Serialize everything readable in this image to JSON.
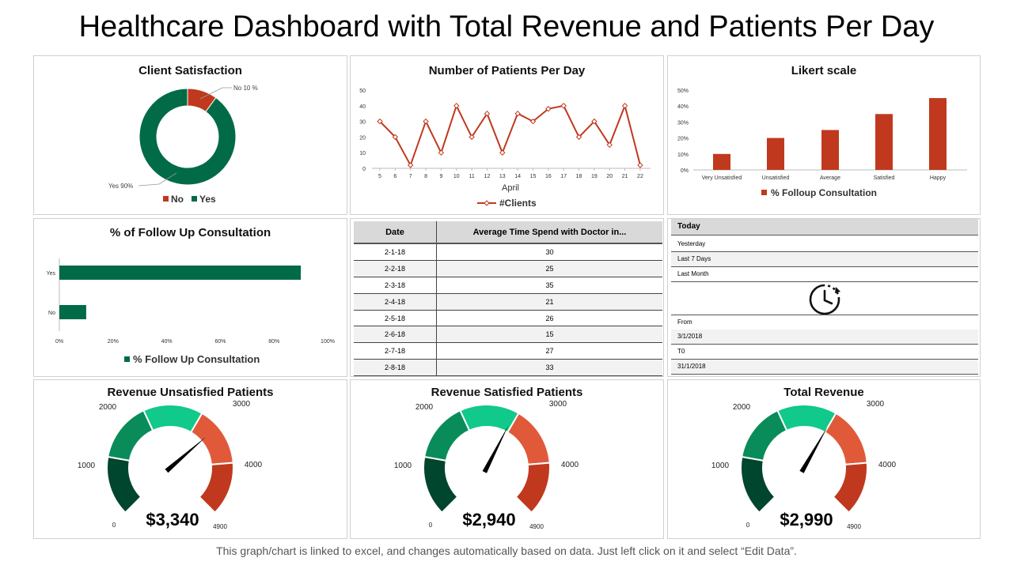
{
  "title": "Healthcare Dashboard with Total Revenue and Patients Per Day",
  "footnote": "This graph/chart is linked to excel, and changes automatically  based on data. Just left click on it and select “Edit Data”.",
  "colors": {
    "green": "#006b46",
    "red": "#c0391e",
    "orange": "#e05a3a",
    "light_green": "#10c98a",
    "mid_green": "#0a8c5a",
    "dark_green": "#00452e"
  },
  "client_satisfaction": {
    "title": "Client Satisfaction",
    "label_no": "No 10  %",
    "label_yes": "Yes 90%",
    "legend_no": "No",
    "legend_yes": "Yes"
  },
  "patients_per_day": {
    "title": "Number of Patients Per Day",
    "xlabel": "April",
    "legend": "#Clients"
  },
  "likert": {
    "title": "Likert scale",
    "legend": "% Folloup Consultation"
  },
  "follow_up": {
    "title": "% of Follow Up Consultation",
    "legend": "% Follow Up Consultation"
  },
  "time_table": {
    "headers": [
      "Date",
      "Average Time Spend with Doctor in..."
    ],
    "rows": [
      [
        "2-1-18",
        "30"
      ],
      [
        "2-2-18",
        "25"
      ],
      [
        "2-3-18",
        "35"
      ],
      [
        "2-4-18",
        "21"
      ],
      [
        "2-5-18",
        "26"
      ],
      [
        "2-6-18",
        "15"
      ],
      [
        "2-7-18",
        "27"
      ],
      [
        "2-8-18",
        "33"
      ]
    ]
  },
  "date_filter": {
    "today": "Today",
    "yesterday": "Yesterday",
    "last7": "Last 7 Days",
    "last_month": "Last Month",
    "from_label": "From",
    "from_value": "3/1/2018",
    "to_label": "T0",
    "to_value": "31/1/2018",
    "icon": "clock-history-icon"
  },
  "gauges": [
    {
      "title": "Revenue Unsatisfied Patients",
      "value_text": "$3,340"
    },
    {
      "title": "Revenue Satisfied Patients",
      "value_text": "$2,940"
    },
    {
      "title": "Total Revenue",
      "value_text": "$2,990"
    }
  ],
  "chart_data": [
    {
      "type": "pie",
      "title": "Client Satisfaction",
      "categories": [
        "No",
        "Yes"
      ],
      "values": [
        10,
        90
      ],
      "colors": [
        "#c0391e",
        "#006b46"
      ],
      "legend": "bottom"
    },
    {
      "type": "line",
      "title": "Number of Patients Per Day",
      "xlabel": "April",
      "x": [
        "5",
        "6",
        "7",
        "8",
        "9",
        "10",
        "11",
        "12",
        "13",
        "14",
        "15",
        "16",
        "17",
        "18",
        "19",
        "20",
        "21",
        "22"
      ],
      "series": [
        {
          "name": "#Clients",
          "values": [
            30,
            20,
            2,
            30,
            10,
            40,
            20,
            35,
            10,
            35,
            30,
            38,
            40,
            20,
            30,
            15,
            40,
            2
          ]
        }
      ],
      "yticks": [
        "0",
        "10",
        "20",
        "30",
        "40",
        "50"
      ],
      "ylim": [
        0,
        50
      ],
      "legend": "bottom"
    },
    {
      "type": "bar",
      "title": "Likert scale",
      "categories": [
        "Very Unsatisfied",
        "Unsatisfied",
        "Average",
        "Satisfied",
        "Happy"
      ],
      "series": [
        {
          "name": "% Folloup Consultation",
          "values": [
            10,
            20,
            25,
            35,
            45
          ]
        }
      ],
      "yticks": [
        "0%",
        "10%",
        "20%",
        "30%",
        "40%",
        "50%"
      ],
      "ylim": [
        0,
        50
      ],
      "legend": "bottom"
    },
    {
      "type": "bar",
      "orientation": "horizontal",
      "title": "% of Follow Up Consultation",
      "categories": [
        "Yes",
        "No"
      ],
      "series": [
        {
          "name": "% Follow Up Consultation",
          "values": [
            90,
            10
          ]
        }
      ],
      "xticks": [
        "0%",
        "20%",
        "40%",
        "60%",
        "80%",
        "100%"
      ],
      "xlim": [
        0,
        100
      ],
      "legend": "bottom"
    },
    {
      "type": "table",
      "headers": [
        "Date",
        "Average Time Spend with Doctor in..."
      ],
      "rows": [
        [
          "2-1-18",
          "30"
        ],
        [
          "2-2-18",
          "25"
        ],
        [
          "2-3-18",
          "35"
        ],
        [
          "2-4-18",
          "21"
        ],
        [
          "2-5-18",
          "26"
        ],
        [
          "2-6-18",
          "15"
        ],
        [
          "2-7-18",
          "27"
        ],
        [
          "2-8-18",
          "33"
        ]
      ]
    },
    {
      "type": "gauge",
      "title": "Revenue Unsatisfied Patients",
      "scale_labels": [
        "0",
        "1000",
        "2000",
        "3000",
        "4000",
        "4900"
      ],
      "range": [
        0,
        4900
      ],
      "value": 3340,
      "value_label": "$3,340"
    },
    {
      "type": "gauge",
      "title": "Revenue Satisfied Patients",
      "scale_labels": [
        "0",
        "1000",
        "2000",
        "3000",
        "4000",
        "4900"
      ],
      "range": [
        0,
        4900
      ],
      "value": 2940,
      "value_label": "$2,940"
    },
    {
      "type": "gauge",
      "title": "Total Revenue",
      "scale_labels": [
        "0",
        "1000",
        "2000",
        "3000",
        "4000",
        "4900"
      ],
      "range": [
        0,
        4900
      ],
      "value": 2990,
      "value_label": "$2,990"
    }
  ]
}
